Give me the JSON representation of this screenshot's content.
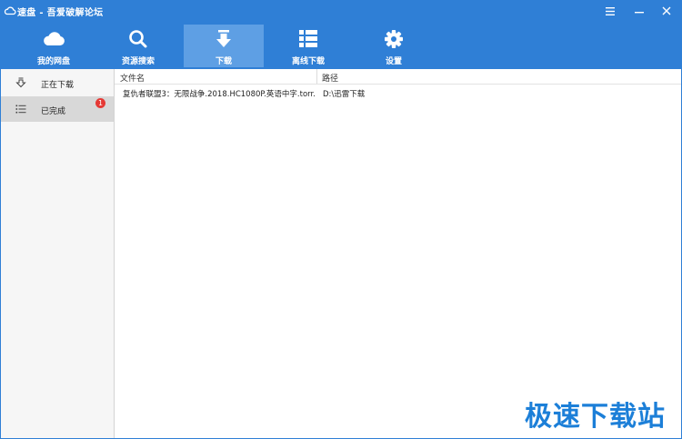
{
  "window": {
    "title": "速盘 - 吾爱破解论坛",
    "controls": [
      "menu-icon",
      "minimize-icon",
      "close-icon"
    ]
  },
  "toolbar": {
    "items": [
      {
        "label": "我的网盘",
        "icon": "cloud-icon"
      },
      {
        "label": "资源搜索",
        "icon": "search-icon"
      },
      {
        "label": "下载",
        "icon": "download-icon",
        "active": true
      },
      {
        "label": "离线下载",
        "icon": "grid-list-icon"
      },
      {
        "label": "设置",
        "icon": "gear-icon"
      }
    ]
  },
  "sidebar": {
    "items": [
      {
        "label": "正在下载",
        "icon": "download-outline-icon"
      },
      {
        "label": "已完成",
        "icon": "list-icon",
        "active": true,
        "badge": "1"
      }
    ]
  },
  "table": {
    "columns": [
      "文件名",
      "路径"
    ],
    "rows": [
      {
        "filename": "复仇者联盟3：无限战争.2018.HC1080P.英语中字.torr...",
        "path": "D:\\迅雷下载"
      }
    ]
  },
  "watermark": "极速下载站",
  "colors": {
    "primary": "#2f7fd6",
    "active_tab": "#5e9fe4",
    "badge": "#e53935",
    "watermark": "#1c7fd8"
  }
}
